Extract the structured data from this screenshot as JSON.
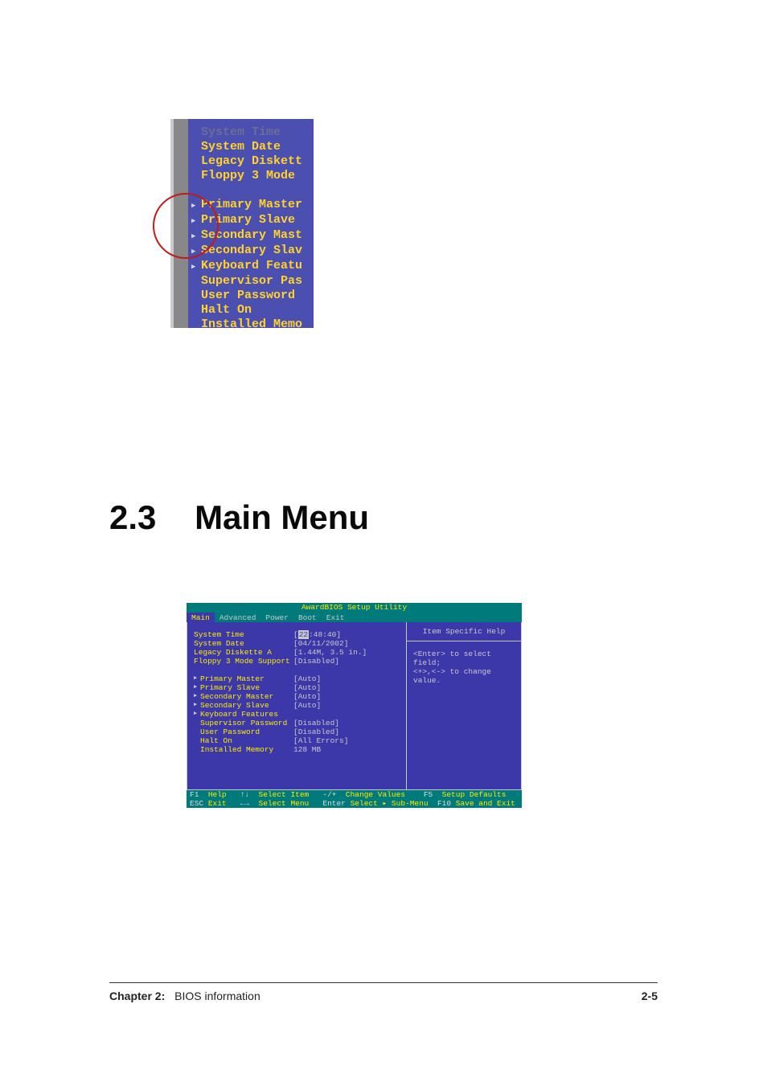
{
  "heading": {
    "number": "2.3",
    "title": "Main Menu"
  },
  "fig1": {
    "lines": [
      {
        "text": "System Time",
        "dim": true,
        "tri": false
      },
      {
        "text": "System Date",
        "dim": false,
        "tri": false
      },
      {
        "text": "Legacy Diskett",
        "dim": false,
        "tri": false
      },
      {
        "text": "Floppy 3 Mode",
        "dim": false,
        "tri": false
      }
    ],
    "lines2": [
      {
        "text": "Primary Master",
        "tri": true
      },
      {
        "text": "Primary Slave",
        "tri": true
      },
      {
        "text": "Secondary Mast",
        "tri": true
      },
      {
        "text": "Secondary Slav",
        "tri": true
      },
      {
        "text": "Keyboard Featu",
        "tri": true
      },
      {
        "text": "Supervisor Pas",
        "tri": false
      },
      {
        "text": "User Password",
        "tri": false
      },
      {
        "text": "Halt On",
        "tri": false
      },
      {
        "text": "Installed Memo",
        "tri": false
      }
    ]
  },
  "bios": {
    "title": "AwardBIOS Setup Utility",
    "tabs": [
      {
        "label": "Main",
        "active": true
      },
      {
        "label": "Advanced",
        "active": false
      },
      {
        "label": "Power",
        "active": false
      },
      {
        "label": "Boot",
        "active": false
      },
      {
        "label": "Exit",
        "active": false
      }
    ],
    "help": {
      "title": "Item Specific Help",
      "line1": "<Enter> to select field;",
      "line2": "<+>,<-> to change value."
    },
    "rows_top": [
      {
        "label": "System Time",
        "value": "[22:48:40]",
        "cursor_prefix": "22",
        "rest": ":48:40]"
      },
      {
        "label": "System Date",
        "value": "[04/11/2002]"
      },
      {
        "label": "Legacy Diskette A",
        "value": "[1.44M, 3.5 in.]"
      },
      {
        "label": "Floppy 3 Mode Support",
        "value": "[Disabled]"
      }
    ],
    "rows_mid": [
      {
        "label": "Primary Master",
        "value": "[Auto]",
        "ptr": true
      },
      {
        "label": "Primary Slave",
        "value": "[Auto]",
        "ptr": true
      },
      {
        "label": "Secondary Master",
        "value": "[Auto]",
        "ptr": true
      },
      {
        "label": "Secondary Slave",
        "value": "[Auto]",
        "ptr": true
      },
      {
        "label": "Keyboard Features",
        "value": "",
        "ptr": true
      }
    ],
    "rows_bot": [
      {
        "label": "Supervisor Password",
        "value": "[Disabled]"
      },
      {
        "label": "User Password",
        "value": "[Disabled]"
      },
      {
        "label": "Halt On",
        "value": "[All Errors]"
      },
      {
        "label": "Installed Memory",
        "value": "128 MB"
      }
    ],
    "footer": {
      "row1": [
        {
          "k": "F1",
          "t": "Help"
        },
        {
          "k": "↑↓",
          "t": "Select Item"
        },
        {
          "k": "-/+",
          "t": "Change Values"
        },
        {
          "k": "F5",
          "t": "Setup Defaults"
        }
      ],
      "row2": [
        {
          "k": "ESC",
          "t": "Exit"
        },
        {
          "k": "←→",
          "t": "Select Menu"
        },
        {
          "k": "Enter",
          "t": "Select ▸ Sub-Menu"
        },
        {
          "k": "F10",
          "t": "Save and Exit"
        }
      ]
    }
  },
  "pageFooter": {
    "chapterNum": "Chapter 2:",
    "chapterTitle": "BIOS information",
    "pageNum": "2-5"
  }
}
